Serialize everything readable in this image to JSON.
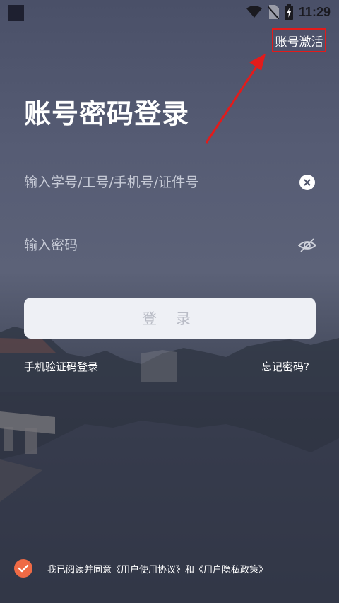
{
  "status_bar": {
    "time": "11:29",
    "icons": [
      "wifi-icon",
      "no-sim-icon",
      "battery-charging-icon"
    ]
  },
  "header": {
    "activate_label": "账号激活"
  },
  "title": "账号密码登录",
  "account_field": {
    "placeholder": "输入学号/工号/手机号/证件号",
    "value": ""
  },
  "password_field": {
    "placeholder": "输入密码",
    "value": ""
  },
  "login_button": {
    "label": "登 录"
  },
  "links": {
    "sms_login": "手机验证码登录",
    "forgot_password": "忘记密码?"
  },
  "agreement": {
    "checked": true,
    "prefix": "我已阅读并同意",
    "user_agreement": "《用户使用协议》",
    "conjunction": "和",
    "privacy_policy": "《用户隐私政策》"
  },
  "colors": {
    "accent_checkbox": "#ef6a45",
    "highlight_box": "#e21b1b",
    "button_bg": "#eef0f5"
  }
}
